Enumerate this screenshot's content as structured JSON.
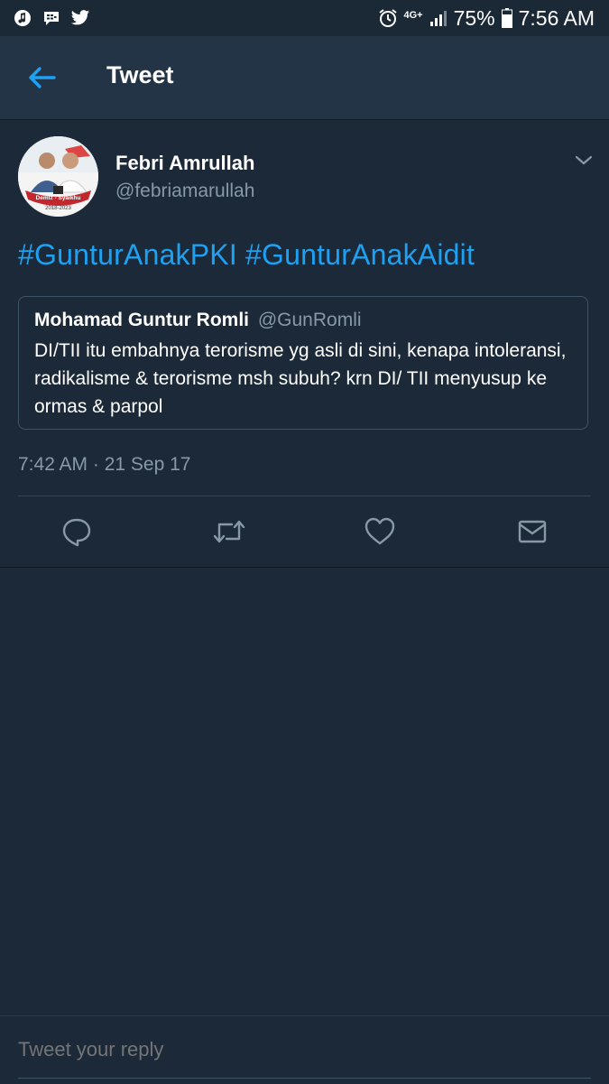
{
  "status_bar": {
    "battery": "75%",
    "time": "7:56 AM",
    "network": "4G+"
  },
  "header": {
    "title": "Tweet"
  },
  "tweet": {
    "author_name": "Febri Amrullah",
    "author_handle": "@febriamarullah",
    "avatar_caption": "Demiz - Syaikhu",
    "avatar_years": "2018-2023",
    "text": "#GunturAnakPKI #GunturAnakAidit",
    "timestamp": "7:42 AM · 21 Sep 17",
    "quote": {
      "author_name": "Mohamad Guntur Romli",
      "author_handle": "@GunRomli",
      "text": "DI/TII itu embahnya terorisme yg asli di sini, kenapa intoleransi, radikalisme & terorisme msh subuh? krn DI/ TII menyusup ke ormas & parpol"
    }
  },
  "actions": [
    "reply-icon",
    "retweet-icon",
    "like-icon",
    "direct-message-icon"
  ],
  "reply": {
    "placeholder": "Tweet your reply"
  },
  "colors": {
    "background": "#1c2938",
    "appbar": "#243447",
    "accent": "#1da1f2",
    "secondary_text": "#8899a6"
  }
}
